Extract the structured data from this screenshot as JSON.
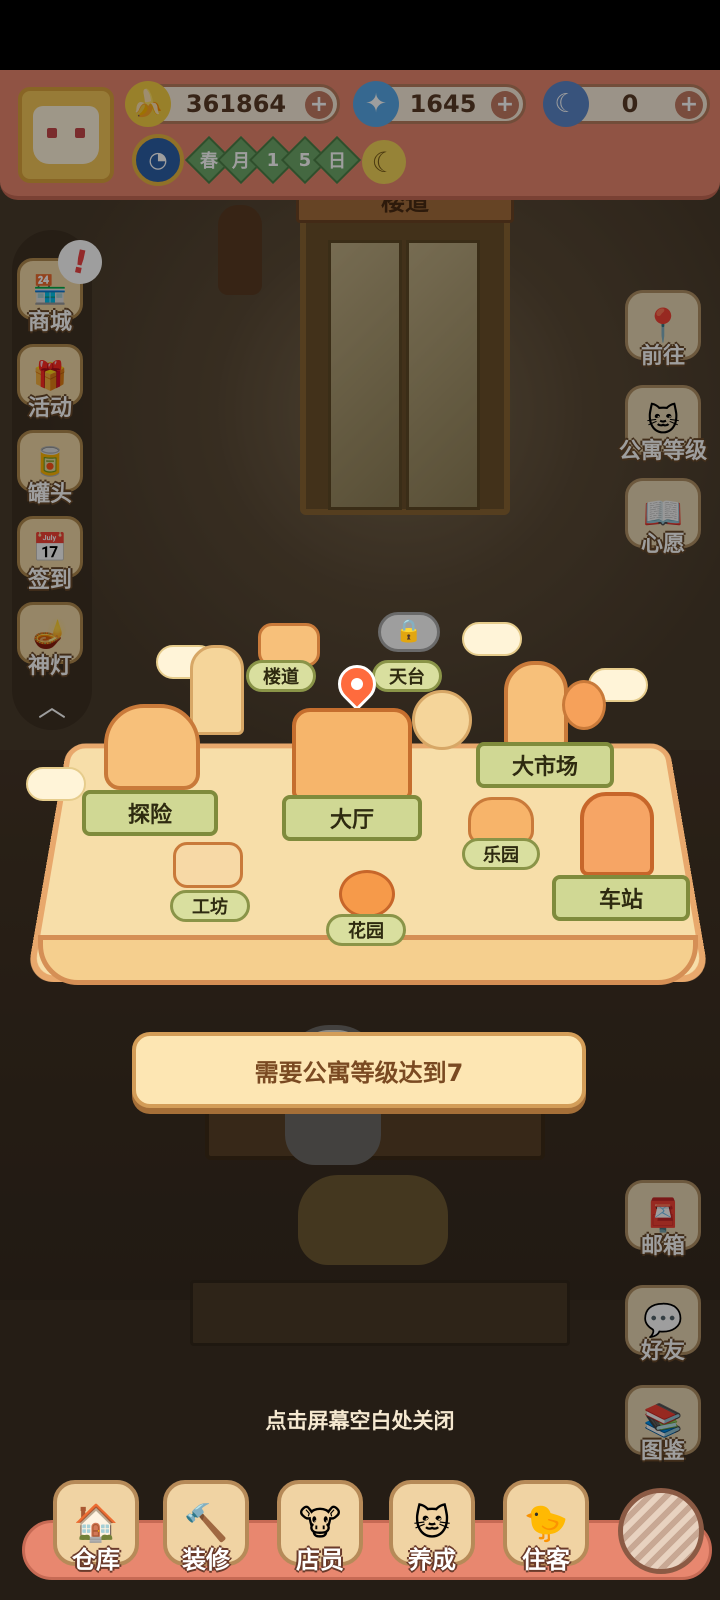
{
  "resources": {
    "bananas": "361864",
    "flames": "1645",
    "blue_bananas": "0",
    "plus": "+"
  },
  "calendar": {
    "chips": [
      "春",
      "月",
      "1",
      "5",
      "日"
    ]
  },
  "left_menu": [
    {
      "label": "商城",
      "icon": "shop-icon"
    },
    {
      "label": "活动",
      "icon": "gift-icon"
    },
    {
      "label": "罐头",
      "icon": "can-icon"
    },
    {
      "label": "签到",
      "icon": "calendar-icon"
    },
    {
      "label": "神灯",
      "icon": "lamp-icon"
    }
  ],
  "left_alert": "!",
  "right_menu": [
    {
      "label": "前往",
      "icon": "map-pin-icon"
    },
    {
      "label": "公寓等级",
      "icon": "badge-icon"
    },
    {
      "label": "心愿",
      "icon": "heart-book-icon"
    },
    {
      "label": "邮箱",
      "icon": "mailbox-icon"
    },
    {
      "label": "好友",
      "icon": "chat-icon"
    },
    {
      "label": "图鉴",
      "icon": "book-icon"
    }
  ],
  "scene": {
    "door_sign": "楼道"
  },
  "map": {
    "locations": {
      "corridor": "楼道",
      "rooftop": "天台",
      "explore": "探险",
      "lobby": "大厅",
      "market": "大市场",
      "workshop": "工坊",
      "playground": "乐园",
      "garden": "花园",
      "station": "车站"
    }
  },
  "toast": "需要公寓等级达到7",
  "hint": "点击屏幕空白处关闭",
  "bottom_nav": [
    {
      "label": "仓库",
      "icon": "warehouse-icon"
    },
    {
      "label": "装修",
      "icon": "hammer-icon"
    },
    {
      "label": "店员",
      "icon": "staff-icon"
    },
    {
      "label": "养成",
      "icon": "cat-grow-icon"
    },
    {
      "label": "住客",
      "icon": "guest-icon"
    }
  ],
  "colors": {
    "topbar": "#e8876f",
    "toast_bg": "#fde6b3",
    "banner": "#d0d894",
    "pin": "#ff6b3d"
  }
}
